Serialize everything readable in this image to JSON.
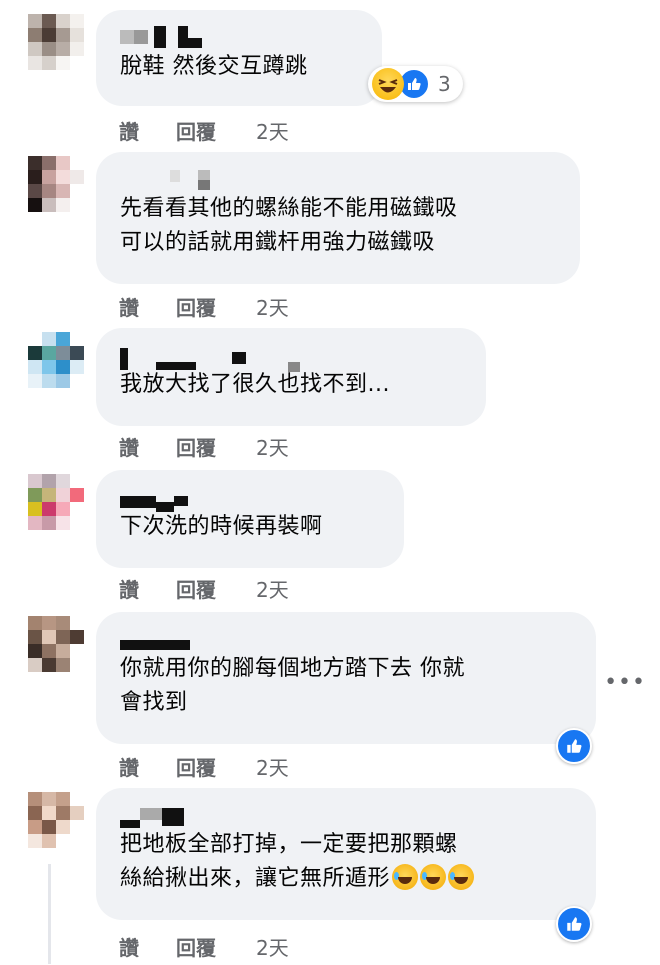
{
  "comments": [
    {
      "text_lines": [
        "脫鞋 然後交互蹲跳"
      ],
      "actions": {
        "like": "讚",
        "reply": "回覆",
        "time": "2天"
      },
      "reactions": {
        "count": "3",
        "icons": [
          "laughing-emoji-icon",
          "like-icon"
        ]
      }
    },
    {
      "text_lines": [
        "先看看其他的螺絲能不能用磁鐵吸",
        "可以的話就用鐵杆用強力磁鐵吸"
      ],
      "actions": {
        "like": "讚",
        "reply": "回覆",
        "time": "2天"
      }
    },
    {
      "text_lines": [
        "我放大找了很久也找不到..."
      ],
      "actions": {
        "like": "讚",
        "reply": "回覆",
        "time": "2天"
      }
    },
    {
      "text_lines": [
        "下次洗的時候再裝啊"
      ],
      "actions": {
        "like": "讚",
        "reply": "回覆",
        "time": "2天"
      }
    },
    {
      "text_lines": [
        "你就用你的腳每個地方踏下去 你就",
        "會找到"
      ],
      "actions": {
        "like": "讚",
        "reply": "回覆",
        "time": "2天"
      },
      "reaction_badge": "like-icon"
    },
    {
      "text_lines": [
        "把地板全部打掉，一定要把那顆螺",
        "絲給揪出來，讓它無所遁形"
      ],
      "actions": {
        "like": "讚",
        "reply": "回覆",
        "time": "2天"
      },
      "reaction_badge": "like-icon",
      "trailing_emojis": [
        "rofl-emoji-icon",
        "rofl-emoji-icon",
        "rofl-emoji-icon"
      ]
    }
  ],
  "more_menu": "•••",
  "colors": {
    "bubble": "#f0f2f5",
    "meta": "#65676b",
    "like_blue": "#1877f2"
  }
}
